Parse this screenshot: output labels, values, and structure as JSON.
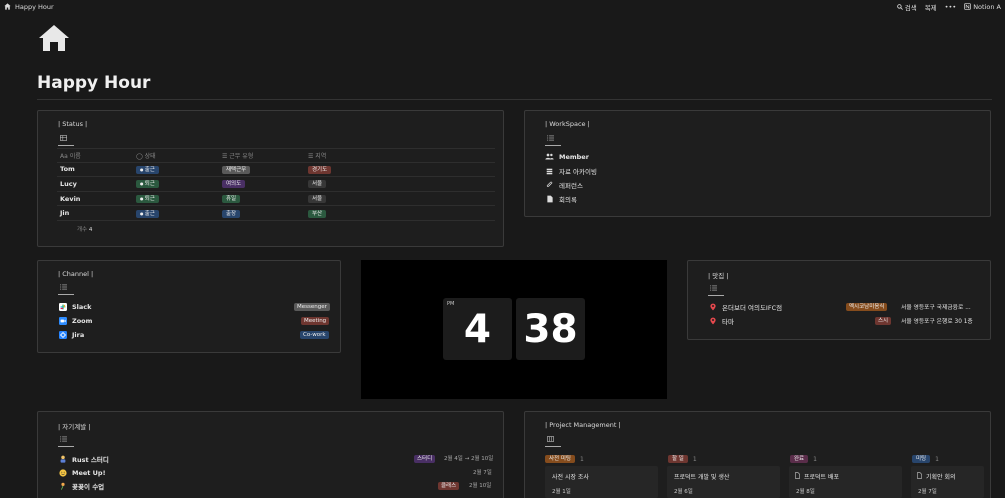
{
  "topbar": {
    "page_name": "Happy Hour",
    "search_label": "검색",
    "duplicate_label": "복제",
    "more_label": "•••",
    "notion_label": "Notion A"
  },
  "page": {
    "title": "Happy Hour",
    "icon": "home-icon"
  },
  "status": {
    "title": "| Status |",
    "columns": [
      "Aa 이름",
      "◯ 상태",
      "☰ 근무 유형",
      "☰ 지역"
    ],
    "rows": [
      {
        "name": "Tom",
        "state": "출근",
        "work": "재택근무",
        "region": "경기도"
      },
      {
        "name": "Lucy",
        "state": "퇴근",
        "work": "여의도",
        "region": "서울"
      },
      {
        "name": "Kevin",
        "state": "퇴근",
        "work": "휴일",
        "region": "서울"
      },
      {
        "name": "Jin",
        "state": "출근",
        "work": "출장",
        "region": "부산"
      }
    ],
    "count_label": "개수",
    "count_value": "4"
  },
  "workspace": {
    "title": "| WorkSpace |",
    "items": [
      "Member",
      "자료 아카이빙",
      "레퍼런스",
      "회의록"
    ]
  },
  "channel": {
    "title": "| Channel |",
    "items": [
      {
        "name": "Slack",
        "tag": "Messenger"
      },
      {
        "name": "Zoom",
        "tag": "Meeting"
      },
      {
        "name": "Jira",
        "tag": "Co-work"
      }
    ]
  },
  "clock": {
    "ampm": "PM",
    "hour": "4",
    "minute": "38"
  },
  "food": {
    "title": "| 맛집 |",
    "items": [
      {
        "name": "온더보더 여의도IFC점",
        "tag": "멕시코남미음식",
        "address": "서울 영등포구 국제금융로 ..."
      },
      {
        "name": "타마",
        "tag": "스시",
        "address": "서울 영등포구 은행로 30 1층"
      }
    ]
  },
  "self_dev": {
    "title": "| 자기계발 |",
    "items": [
      {
        "name": "Rust 스터디",
        "tag": "스터디",
        "date": "2월 4일 → 2월 10일"
      },
      {
        "name": "Meet Up!",
        "tag": "",
        "date": "2월 7일"
      },
      {
        "name": "꽃꽂이 수업",
        "tag": "클래스",
        "date": "2월 10일"
      }
    ]
  },
  "project": {
    "title": "| Project Management |",
    "columns": [
      {
        "label": "사전 미팅",
        "count": "1",
        "card_title": "사전 시장 조사",
        "card_date": "2월 1일"
      },
      {
        "label": "할 일",
        "count": "1",
        "card_title": "프로덕트 개발 및 생산",
        "card_date": "2월 6일"
      },
      {
        "label": "완료",
        "count": "1",
        "card_title": "프로덕트 배포",
        "card_date": "2월 8일"
      },
      {
        "label": "미팅",
        "count": "1",
        "card_title": "기획안 회의",
        "card_date": "2월 7일"
      }
    ]
  },
  "colors": {
    "background": "#191919",
    "tag_blue": "#28456c",
    "tag_green": "#2b593f",
    "tag_gray": "#5a5a5a",
    "tag_purple": "#492f64",
    "tag_red": "#6e3630",
    "tag_brown": "#603b2c",
    "tag_orange": "#854c1d"
  }
}
